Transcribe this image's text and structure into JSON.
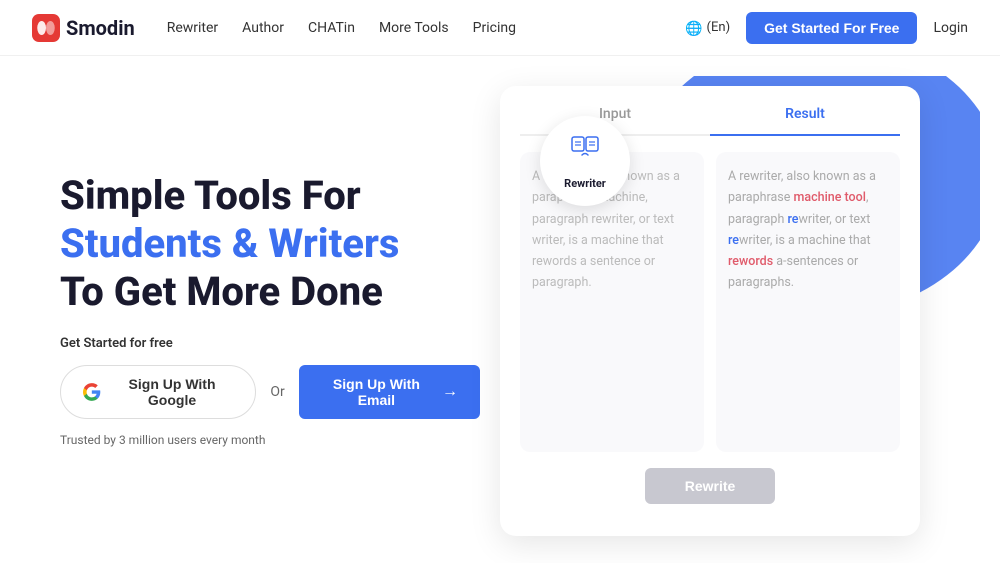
{
  "nav": {
    "logo_text": "Smodin",
    "links": [
      {
        "label": "Rewriter",
        "id": "rewriter"
      },
      {
        "label": "Author",
        "id": "author"
      },
      {
        "label": "CHATin",
        "id": "chatin"
      },
      {
        "label": "More Tools",
        "id": "more-tools"
      },
      {
        "label": "Pricing",
        "id": "pricing"
      }
    ],
    "lang": "🌐 (En)",
    "cta_label": "Get Started For Free",
    "login_label": "Login"
  },
  "hero": {
    "title_line1": "Simple Tools For",
    "title_line2": "Students & Writers",
    "title_line3": "To Get More Done",
    "subtitle": "Get Started for free",
    "btn_google": "Sign Up With Google",
    "btn_or": "Or",
    "btn_email": "Sign Up With Email",
    "trust": "Trusted by 3 million users every month"
  },
  "demo": {
    "badge_label": "Rewriter",
    "tab_input": "Input",
    "tab_result": "Result",
    "input_text": "A rewriter, also known as a paraphrase machine, paragraph rewriter, or text writer, is a machine that rewords a sentence or paragraph.",
    "result_text_parts": [
      {
        "text": "A rewriter, also known as a paraphrase ",
        "type": "normal"
      },
      {
        "text": "machine tool",
        "type": "red"
      },
      {
        "text": ", paragraph ",
        "type": "normal"
      },
      {
        "text": "re",
        "type": "blue"
      },
      {
        "text": "writer, or text ",
        "type": "normal"
      },
      {
        "text": "re",
        "type": "blue"
      },
      {
        "text": "writer, is a machine that ",
        "type": "normal"
      },
      {
        "text": "rewords",
        "type": "red"
      },
      {
        "text": " a-sentences or paragraphs.",
        "type": "normal"
      }
    ],
    "rewrite_btn": "Rewrite"
  }
}
